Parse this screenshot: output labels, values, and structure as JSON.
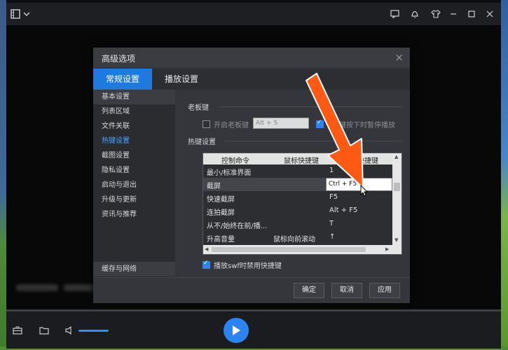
{
  "dialog": {
    "title": "高级选项",
    "close": "×"
  },
  "tabs": [
    {
      "label": "常规设置",
      "active": true
    },
    {
      "label": "播放设置",
      "active": false
    }
  ],
  "sidebar": {
    "items": [
      {
        "label": "基本设置"
      },
      {
        "label": "列表区域"
      },
      {
        "label": "文件关联"
      },
      {
        "label": "热键设置",
        "active": true
      },
      {
        "label": "截图设置"
      },
      {
        "label": "隐私设置"
      },
      {
        "label": "启动与退出"
      },
      {
        "label": "升级与更新"
      },
      {
        "label": "资讯与推荐"
      }
    ],
    "bottom_item": "缓存与网络"
  },
  "boss_key": {
    "section_label": "老板键",
    "enable_label": "开启老板键",
    "enable_checked": false,
    "key_value": "Alt + S",
    "pause_label": "键按下时暂停播放",
    "pause_checked": true
  },
  "hotkeys": {
    "section_label": "热键设置",
    "columns": [
      "控制命令",
      "鼠标快捷键",
      "键盘快捷键"
    ],
    "rows": [
      {
        "command": "最小/标准界面",
        "mouse": "",
        "keyboard": "1"
      },
      {
        "command": "截屏",
        "mouse": "",
        "keyboard": "Ctrl + F5",
        "editing": true
      },
      {
        "command": "快速截屏",
        "mouse": "",
        "keyboard": "F5"
      },
      {
        "command": "连拍截屏",
        "mouse": "",
        "keyboard": "Alt + F5"
      },
      {
        "command": "从不/始终在前/播...",
        "mouse": "",
        "keyboard": "T"
      },
      {
        "command": "升高音量",
        "mouse": "鼠标向前滚动",
        "keyboard": "↑"
      }
    ],
    "swf_label": "播放swf时禁用快捷键",
    "swf_checked": true
  },
  "buttons": {
    "ok": "确定",
    "cancel": "取消",
    "apply": "应用"
  },
  "colors": {
    "accent": "#1f7ae0",
    "annotation_arrow": "#ff5a14"
  },
  "volume": {
    "level": 1.0
  }
}
